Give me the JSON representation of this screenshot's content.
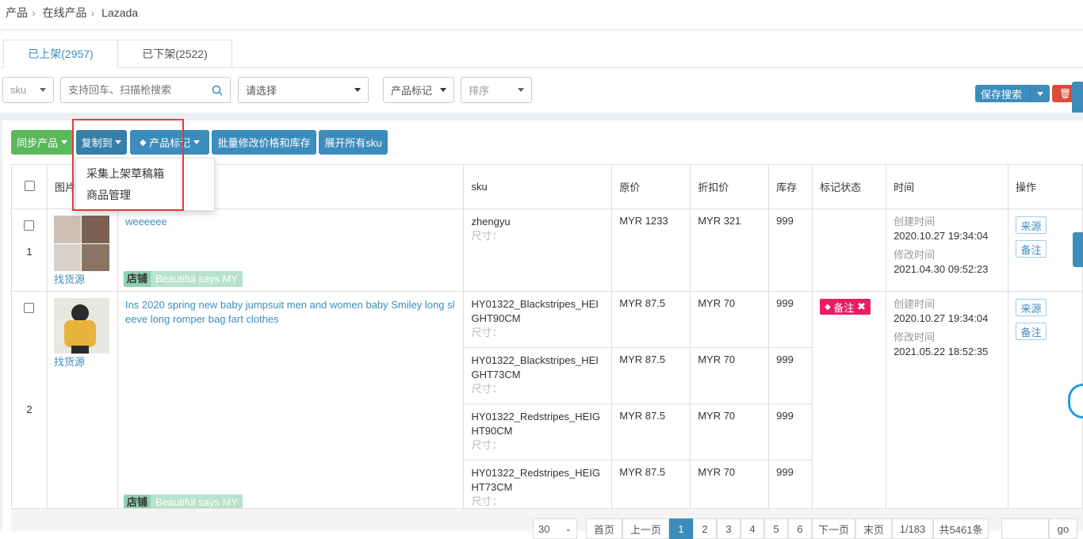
{
  "breadcrumb": {
    "items": [
      "产品",
      "在线产品",
      "Lazada"
    ]
  },
  "tabs": [
    {
      "label": "已上架(2957)"
    },
    {
      "label": "已下架(2522)"
    }
  ],
  "filters": {
    "sku_select": "sku",
    "search_placeholder": "支持回车、扫描枪搜索",
    "select_placeholder": "请选择",
    "mark_select": "产品标记",
    "sort_select": "排序"
  },
  "actions": {
    "save_search": "保存搜索",
    "sync": "同步产品",
    "copy_to": "复制到",
    "product_mark": "产品标记",
    "batch_edit": "批量修改价格和库存",
    "expand_all": "展开所有sku"
  },
  "dropdown": {
    "items": [
      "采集上架草稿箱",
      "商品管理"
    ]
  },
  "table": {
    "headers": {
      "image": "图片",
      "sku": "sku",
      "price": "原价",
      "discount": "折扣价",
      "stock": "库存",
      "mark": "标记状态",
      "time": "时间",
      "ops": "操作"
    },
    "size_label": "尺寸：",
    "find_source": "找货源",
    "store_tag": "店铺",
    "store_name": "Beautiful says MY",
    "created_label": "创建时间",
    "modified_label": "修改时间",
    "op_source": "来源",
    "op_note": "备注",
    "note_badge": "备注",
    "rows": [
      {
        "index": "1",
        "title": "weeeeee",
        "created": "2020.10.27 19:34:04",
        "modified": "2021.04.30 09:52:23",
        "skus": [
          {
            "sku": "zhengyu",
            "price": "MYR 1233",
            "discount": "MYR 321",
            "stock": "999"
          }
        ]
      },
      {
        "index": "2",
        "title": "Ins 2020 spring new baby jumpsuit men and women baby Smiley long sleeve long romper bag fart clothes",
        "created": "2020.10.27 19:34:04",
        "modified": "2021.05.22 18:52:35",
        "skus": [
          {
            "sku": "HY01322_Blackstripes_HEIGHT90CM",
            "price": "MYR 87.5",
            "discount": "MYR 70",
            "stock": "999"
          },
          {
            "sku": "HY01322_Blackstripes_HEIGHT73CM",
            "price": "MYR 87.5",
            "discount": "MYR 70",
            "stock": "999"
          },
          {
            "sku": "HY01322_Redstripes_HEIGHT90CM",
            "price": "MYR 87.5",
            "discount": "MYR 70",
            "stock": "999"
          },
          {
            "sku": "HY01322_Redstripes_HEIGHT73CM",
            "price": "MYR 87.5",
            "discount": "MYR 70",
            "stock": "999"
          }
        ]
      }
    ]
  },
  "pagination": {
    "per_page": "30",
    "first": "首页",
    "prev": "上一页",
    "pages": [
      "1",
      "2",
      "3",
      "4",
      "5",
      "6"
    ],
    "next": "下一页",
    "last": "末页",
    "status": "1/183",
    "total": "共5461条",
    "go": "go"
  },
  "colors": {
    "primary": "#3c8dbc",
    "success": "#5cb85c",
    "danger": "#dd4b39",
    "note_badge": "#e91e63"
  }
}
